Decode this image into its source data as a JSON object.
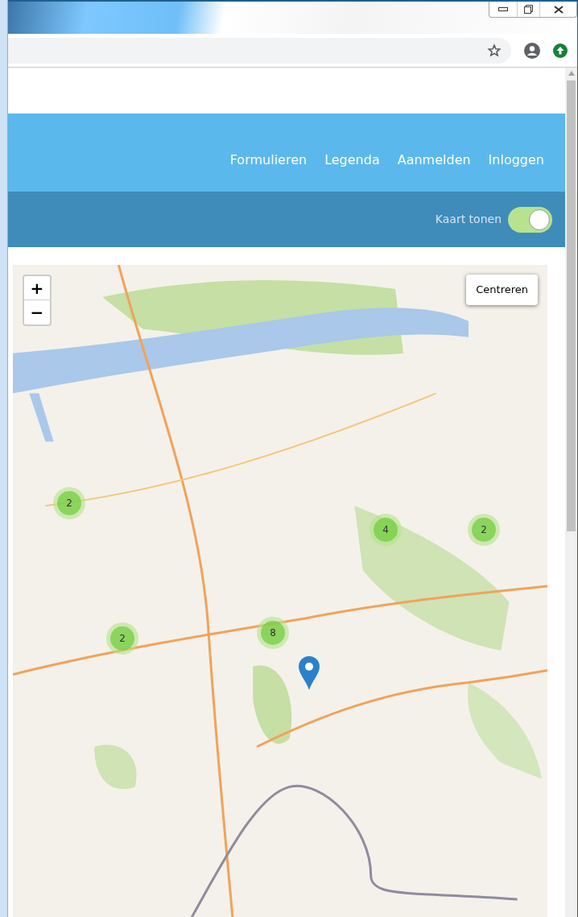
{
  "nav": {
    "items": [
      {
        "label": "Formulieren"
      },
      {
        "label": "Legenda"
      },
      {
        "label": "Aanmelden"
      },
      {
        "label": "Inloggen"
      }
    ]
  },
  "toolbar": {
    "toggle": {
      "label": "Kaart tonen",
      "on": true
    }
  },
  "map": {
    "zoom_in": "+",
    "zoom_out": "−",
    "center_button": "Centreren",
    "clusters": [
      {
        "count": "2"
      },
      {
        "count": "4"
      },
      {
        "count": "2"
      },
      {
        "count": "8"
      },
      {
        "count": "2"
      }
    ]
  }
}
